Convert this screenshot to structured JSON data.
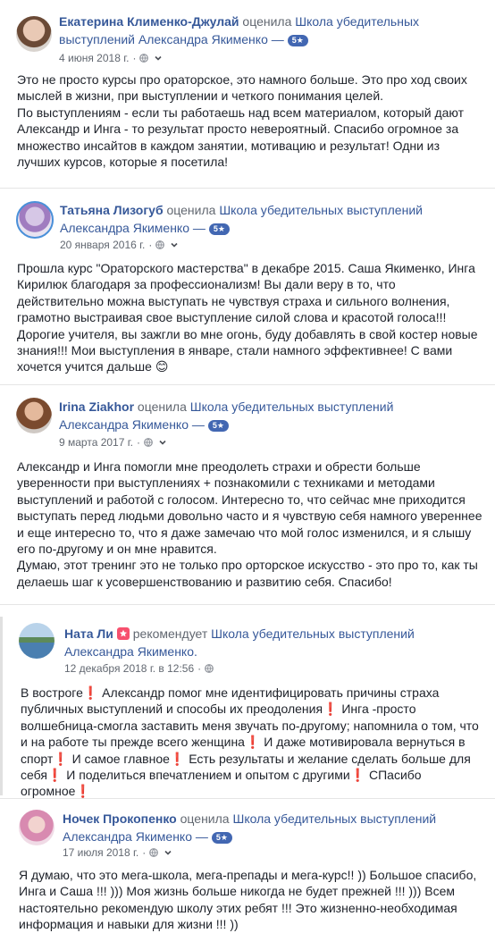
{
  "reviews": [
    {
      "author": "Екатерина Клименко-Джулай",
      "action": "оценила",
      "page": "Школа убедительных выступлений Александра Якименко —",
      "badge": "5★",
      "date": "4 июня 2018 г.",
      "lines": [
        "Это не просто курсы про ораторское, это намного больше. Это про ход своих",
        "мыслей в жизни, при выступлении и четкого понимания целей.",
        "По выступлениям - если ты работаешь над всем материалом, который дают",
        "Александр и Инга - то результат просто невероятный. Спасибо огромное за",
        "множество инсайтов в каждом занятии, мотивацию и результат! Одни из",
        "лучших курсов, которые я посетила!"
      ]
    },
    {
      "author": "Татьяна Лизогуб",
      "action": "оценила",
      "page": "Школа убедительных выступлений Александра Якименко —",
      "badge": "5★",
      "date": "20 января 2016 г.",
      "lines": [
        "Прошла курс \"Ораторского мастерства\" в декабре 2015. Саша Якименко, Инга",
        "Кирилюк благодаря за профессионализм! Вы дали веру в то, что",
        "действительно можна выступать не чувствуя страха и сильного волнения,",
        "грамотно выстраивая свое выступление силой слова и красотой голоса!!!",
        "Дорогие учителя, вы зажгли во мне огонь, буду добавлять в свой костер новые",
        "знания!!! Мои выступления в январе, стали намного эффективнее! С вами",
        "хочется учится дальше 😊"
      ]
    },
    {
      "author": "Irina Ziakhor",
      "action": "оценила",
      "page": "Школа убедительных выступлений Александра Якименко —",
      "badge": "5★",
      "date": "9 марта 2017 г.",
      "lines": [
        "Александр и Инга помогли мне преодолеть страхи и обрести больше",
        "уверенности при выступлениях + познакомили с техниками и методами",
        "выступлений и работой с голосом. Интересно то, что сейчас мне приходится",
        "выступать перед людьми довольно часто и я чувствую себя намного увереннее",
        "и еще интересно то, что я даже замечаю что мой голос изменился, и я слышу",
        "его по-другому и он мне нравится.",
        "Думаю, этот тренинг это не только про орторское искусство - это про то, как ты",
        "делаешь шаг к усовершенствованию и развитию себя. Спасибо!"
      ]
    },
    {
      "author": "Ната Ли",
      "action": "рекомендует",
      "page": "Школа убедительных выступлений Александра Якименко.",
      "date": "12 декабря 2018 г. в 12:56",
      "lines": [
        "В востроге❗ Александр помог мне идентифицировать причины страха",
        "публичных выступлений и способы их преодоления❗ Инга -просто",
        "волшебница-смогла заставить меня звучать по-другому; напомнила о том, что",
        "и на работе ты прежде всего женщина❗ И даже мотивировала вернуться в",
        "спорт❗ И самое главное❗ Есть результаты и желание сделать больше для",
        "себя❗ И поделиться впечатлением и опытом с другими❗ СПасибо огромное❗"
      ]
    },
    {
      "author": "Ночек Прокопенко",
      "action": "оценила",
      "page": "Школа убедительных выступлений Александра Якименко —",
      "badge": "5★",
      "date": "17 июля 2018 г.",
      "lines": [
        "Я думаю, что это мега-школа, мега-препады и мега-курс!! )) Большое спасибо,",
        "Инга и Саша !!! ))) Моя жизнь больше никогда не будет прежней !!! ))) Всем",
        "настоятельно рекомендую школу этих ребят !!! Это жизненно-необходимая",
        "информация и навыки для жизни !!! ))"
      ]
    }
  ],
  "icons": {
    "privacy": "globe-icon",
    "menu": "chevron-down-icon",
    "recommend": "star-badge-icon"
  },
  "colors": {
    "link": "#365899",
    "meta": "#616770",
    "text": "#1d2129",
    "badge": "#4267b2",
    "recommend": "#f7506e"
  }
}
